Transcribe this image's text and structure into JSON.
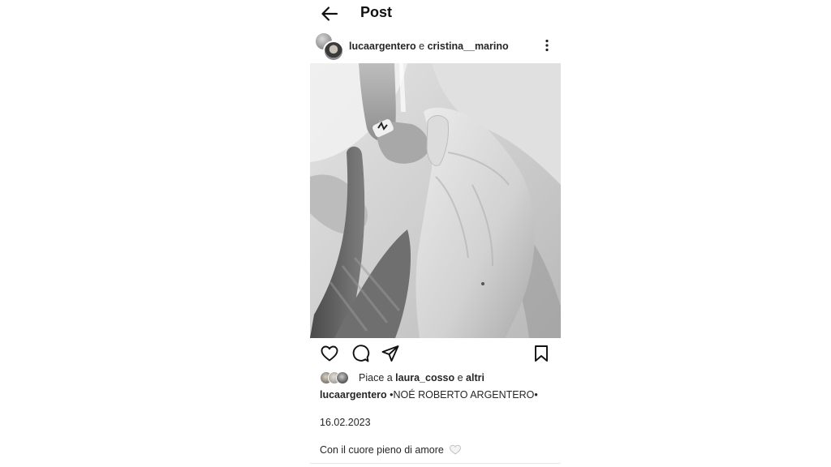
{
  "header": {
    "title": "Post"
  },
  "post": {
    "author_primary": "lucaargentero",
    "author_joiner": " e ",
    "author_secondary": "cristina__marino"
  },
  "likes": {
    "prefix": "Piace a ",
    "user": "laura_cosso",
    "joiner": " e ",
    "suffix": "altri"
  },
  "caption": {
    "username": "lucaargentero",
    "text": " •NOÉ ROBERTO ARGENTERO•"
  },
  "body": {
    "date": "16.02.2023",
    "message": "Con il cuore pieno di amore"
  },
  "icons": {
    "back": "arrow-left-icon",
    "more": "more-vertical-icon",
    "like": "heart-icon",
    "comment": "comment-icon",
    "share": "send-icon",
    "save": "bookmark-icon",
    "message_emoji": "white-heart-emoji"
  },
  "colors": {
    "text": "#262626",
    "background": "#ffffff"
  }
}
